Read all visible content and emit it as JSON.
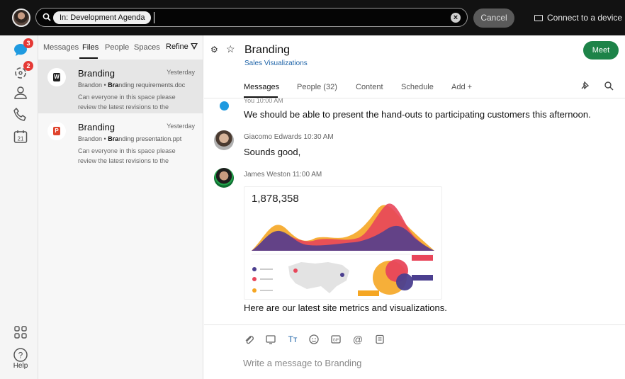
{
  "topbar": {
    "avatar_icon": "user-avatar",
    "search": {
      "filter_label": "In: Development Agenda",
      "placeholder": ""
    },
    "cancel_label": "Cancel",
    "connect_label": "Connect to a device"
  },
  "rail": {
    "items": [
      {
        "name": "messaging",
        "icon": "chat-bubble-icon",
        "badge": "3"
      },
      {
        "name": "teams",
        "icon": "teams-icon",
        "badge": "2"
      },
      {
        "name": "contacts",
        "icon": "person-icon"
      },
      {
        "name": "calls",
        "icon": "phone-icon"
      },
      {
        "name": "meetings",
        "icon": "calendar-icon",
        "label": "21"
      },
      {
        "name": "apps",
        "icon": "apps-grid-icon"
      }
    ],
    "help_label": "Help"
  },
  "search_panel": {
    "tabs": [
      "Messages",
      "Files",
      "People",
      "Spaces"
    ],
    "active_tab": "Files",
    "refine_label": "Refine",
    "results": [
      {
        "title": "Branding",
        "time": "Yesterday",
        "author": "Brandon",
        "file_match": "Bra",
        "file_rest": "nding requirements.doc",
        "snippet": "Can everyone in this space please review the latest revisions to the",
        "file_type": "word",
        "file_letter": "W"
      },
      {
        "title": "Branding",
        "time": "Yesterday",
        "author": "Brandon",
        "file_match": "Bra",
        "file_rest": "nding presentation.ppt",
        "snippet": "Can everyone in this space please review the latest revisions to the",
        "file_type": "ppt",
        "file_letter": "P"
      }
    ]
  },
  "space": {
    "title": "Branding",
    "subtitle": "Sales Visualizations",
    "meet_label": "Meet",
    "tabs": [
      "Messages",
      "People (32)",
      "Content",
      "Schedule",
      "Add +"
    ],
    "active_tab": "Messages"
  },
  "messages": [
    {
      "sender": "You",
      "time": "10:00 AM",
      "text": "We should be able to present the hand-outs to participating customers this afternoon."
    },
    {
      "sender": "Giacomo Edwards",
      "time": "10:30 AM",
      "text": "Sounds good,"
    },
    {
      "sender": "James Weston",
      "time": "11:00 AM",
      "attachment_metric": "1,878,358",
      "text": "Here are our latest site metrics and visualizations."
    }
  ],
  "composer": {
    "placeholder": "Write a message to Branding",
    "tools": [
      "attach-icon",
      "screen-share-icon",
      "text-format-icon",
      "emoji-icon",
      "gif-icon",
      "mention-icon",
      "whiteboard-icon"
    ]
  },
  "colors": {
    "topbar_bg": "#121212",
    "meet_green": "#1d8348",
    "badge_red": "#e53935",
    "link_blue": "#1f64a8",
    "chart_purple": "#4b3f8f",
    "chart_red": "#e8465a",
    "chart_orange": "#f5a623"
  }
}
